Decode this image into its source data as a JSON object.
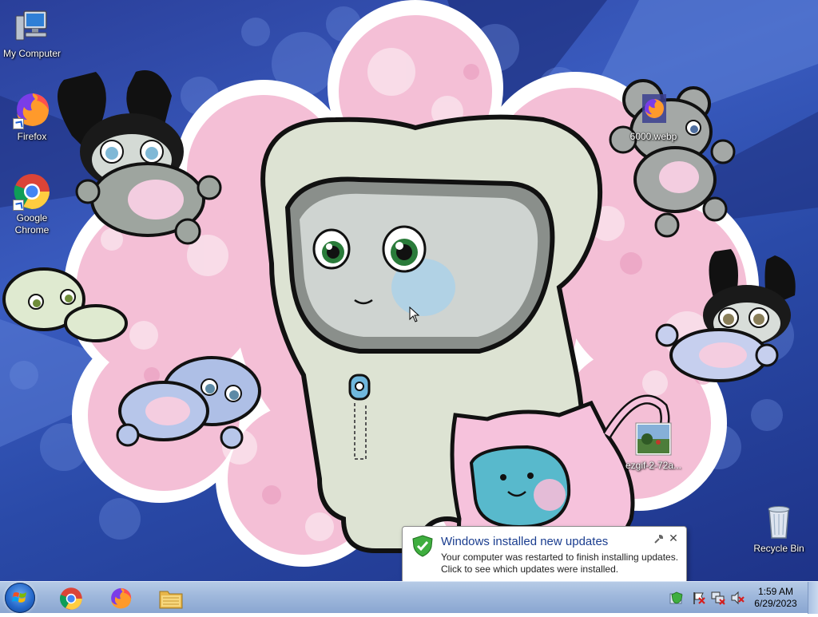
{
  "desktop": {
    "icons": [
      {
        "label": "My Computer",
        "icon": "computer-icon"
      },
      {
        "label": "Firefox",
        "icon": "firefox-icon"
      },
      {
        "label": "Google Chrome",
        "icon": "chrome-icon"
      },
      {
        "label": "6000.webp",
        "icon": "firefox-file-icon"
      },
      {
        "label": "ezgif-2-72a...",
        "icon": "image-thumbnail-icon"
      },
      {
        "label": "Recycle Bin",
        "icon": "recycle-bin-icon"
      }
    ]
  },
  "notification": {
    "title": "Windows installed new updates",
    "line1": "Your computer was restarted to finish installing updates.",
    "line2": "Click to see which updates were installed.",
    "close_glyph": "✕"
  },
  "taskbar": {
    "pinned": [
      "chrome-icon",
      "firefox-icon",
      "file-explorer-icon"
    ],
    "tray_icons": [
      "windows-update-icon",
      "action-center-flag-icon",
      "network-icon",
      "volume-muted-icon"
    ],
    "clock": {
      "time": "1:59 AM",
      "date": "6/29/2023"
    }
  },
  "colors": {
    "taskbar": "#9fb8dc",
    "balloon_title": "#1a3d8f",
    "accent_blue": "#2467c9"
  }
}
